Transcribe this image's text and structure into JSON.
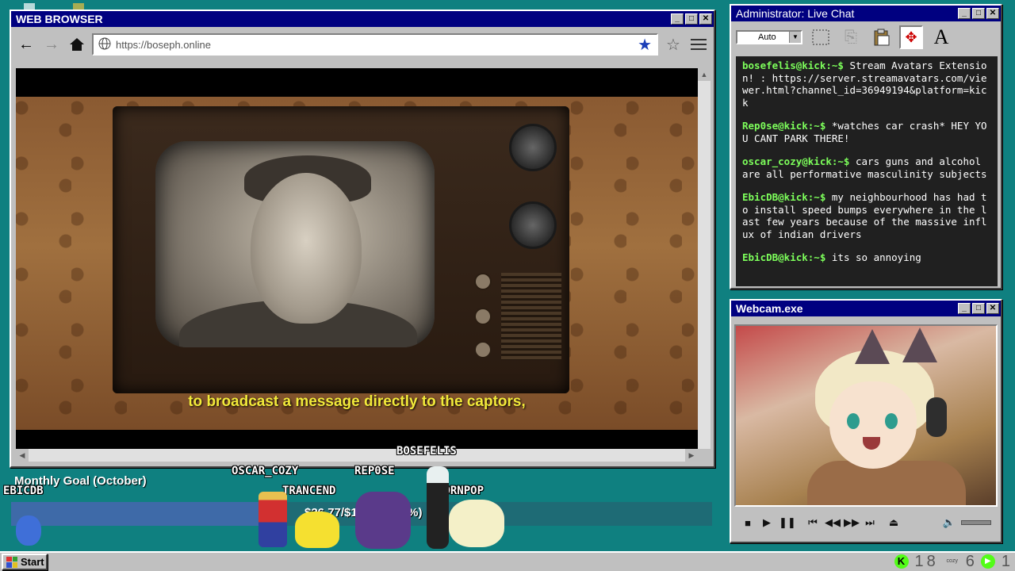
{
  "browser": {
    "title": "WEB BROWSER",
    "url_placeholder": "https://boseph.online",
    "subtitle": "to broadcast a message directly to the captors,"
  },
  "chat": {
    "title": "Administrator: Live Chat",
    "font_select": "Auto",
    "messages": [
      {
        "user": "bosefelis@kick:~$",
        "text": "Stream Avatars Extension! : https://server.streamavatars.com/viewer.html?channel_id=36949194&platform=kick"
      },
      {
        "user": "Rep0se@kick:~$",
        "text": "*watches car crash* HEY YOU CANT PARK THERE!"
      },
      {
        "user": "oscar_cozy@kick:~$",
        "text": "cars guns and alcohol are all performative masculinity subjects"
      },
      {
        "user": "EbicDB@kick:~$",
        "text": "my neighbourhood has had to install speed bumps everywhere in the last few years because of the massive influx of indian drivers"
      },
      {
        "user": "EbicDB@kick:~$",
        "text": "its so annoying"
      }
    ],
    "user_color": "#7dff5b"
  },
  "webcam": {
    "title": "Webcam.exe"
  },
  "overlay": {
    "goal_title": "Monthly Goal (October)",
    "goal_text": "$26.77/$100.00 (39%)",
    "goal_fraction": 0.39,
    "viewer_tags": [
      "BOSEFELIS",
      "OSCAR_COZY",
      "REP0SE",
      "TRANCEND",
      "CORNPOP",
      "EBICDB"
    ]
  },
  "taskbar": {
    "start_label": "Start",
    "tray_count_1": "18",
    "tray_count_2": "6",
    "tray_count_3": "1",
    "cozy_label": "cozy"
  },
  "colors": {
    "desktop": "#0f8080",
    "titlebar": "#000080",
    "accent_green": "#53fc18"
  }
}
